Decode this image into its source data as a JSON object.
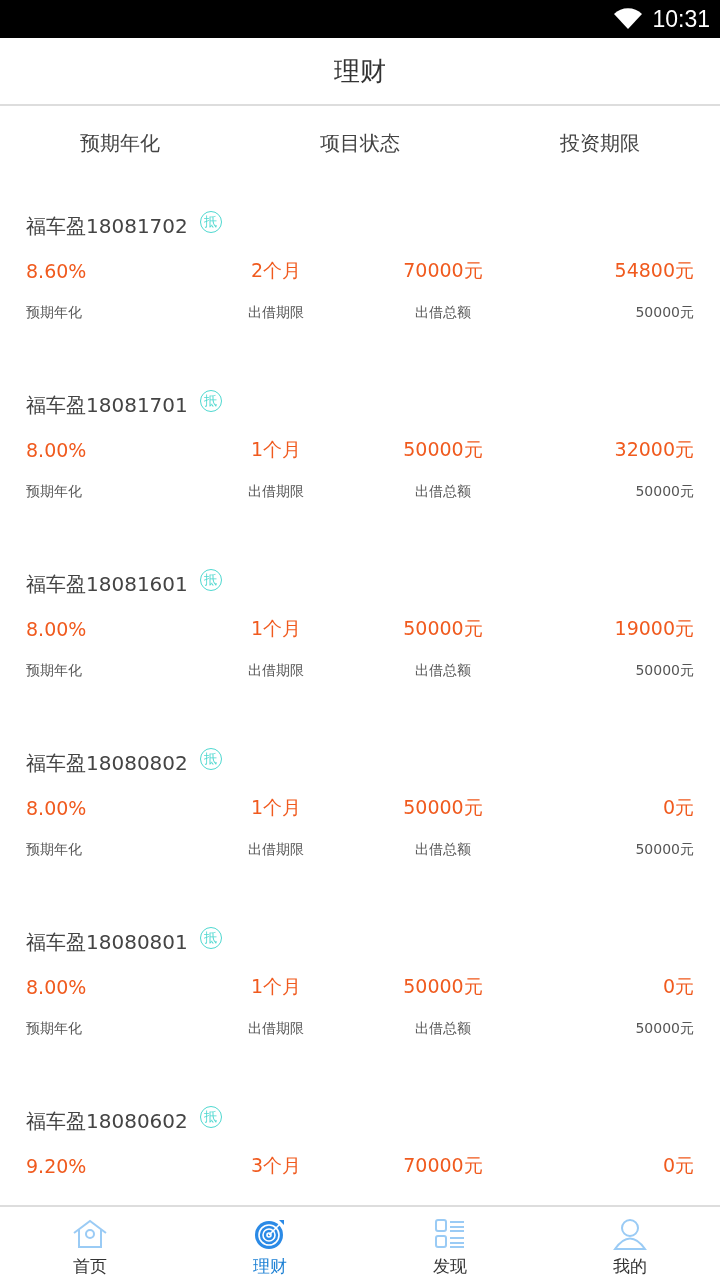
{
  "status_bar": {
    "time": "10:31"
  },
  "header": {
    "title": "理财"
  },
  "filters": [
    "预期年化",
    "项目状态",
    "投资期限"
  ],
  "products": [
    {
      "name": "福车盈18081702",
      "badge": "抵",
      "rate": "8.60%",
      "term": "2个月",
      "total": "70000元",
      "remaining": "54800元",
      "labels": [
        "预期年化",
        "出借期限",
        "出借总额",
        "50000元"
      ]
    },
    {
      "name": "福车盈18081701",
      "badge": "抵",
      "rate": "8.00%",
      "term": "1个月",
      "total": "50000元",
      "remaining": "32000元",
      "labels": [
        "预期年化",
        "出借期限",
        "出借总额",
        "50000元"
      ]
    },
    {
      "name": "福车盈18081601",
      "badge": "抵",
      "rate": "8.00%",
      "term": "1个月",
      "total": "50000元",
      "remaining": "19000元",
      "labels": [
        "预期年化",
        "出借期限",
        "出借总额",
        "50000元"
      ]
    },
    {
      "name": "福车盈18080802",
      "badge": "抵",
      "rate": "8.00%",
      "term": "1个月",
      "total": "50000元",
      "remaining": "0元",
      "labels": [
        "预期年化",
        "出借期限",
        "出借总额",
        "50000元"
      ]
    },
    {
      "name": "福车盈18080801",
      "badge": "抵",
      "rate": "8.00%",
      "term": "1个月",
      "total": "50000元",
      "remaining": "0元",
      "labels": [
        "预期年化",
        "出借期限",
        "出借总额",
        "50000元"
      ]
    },
    {
      "name": "福车盈18080602",
      "badge": "抵",
      "rate": "9.20%",
      "term": "3个月",
      "total": "70000元",
      "remaining": "0元"
    }
  ],
  "tab_bar": [
    {
      "label": "首页",
      "kind": "home",
      "selected": false
    },
    {
      "label": "理财",
      "kind": "invest",
      "selected": true
    },
    {
      "label": "发现",
      "kind": "discover",
      "selected": false
    },
    {
      "label": "我的",
      "kind": "profile",
      "selected": false
    }
  ]
}
